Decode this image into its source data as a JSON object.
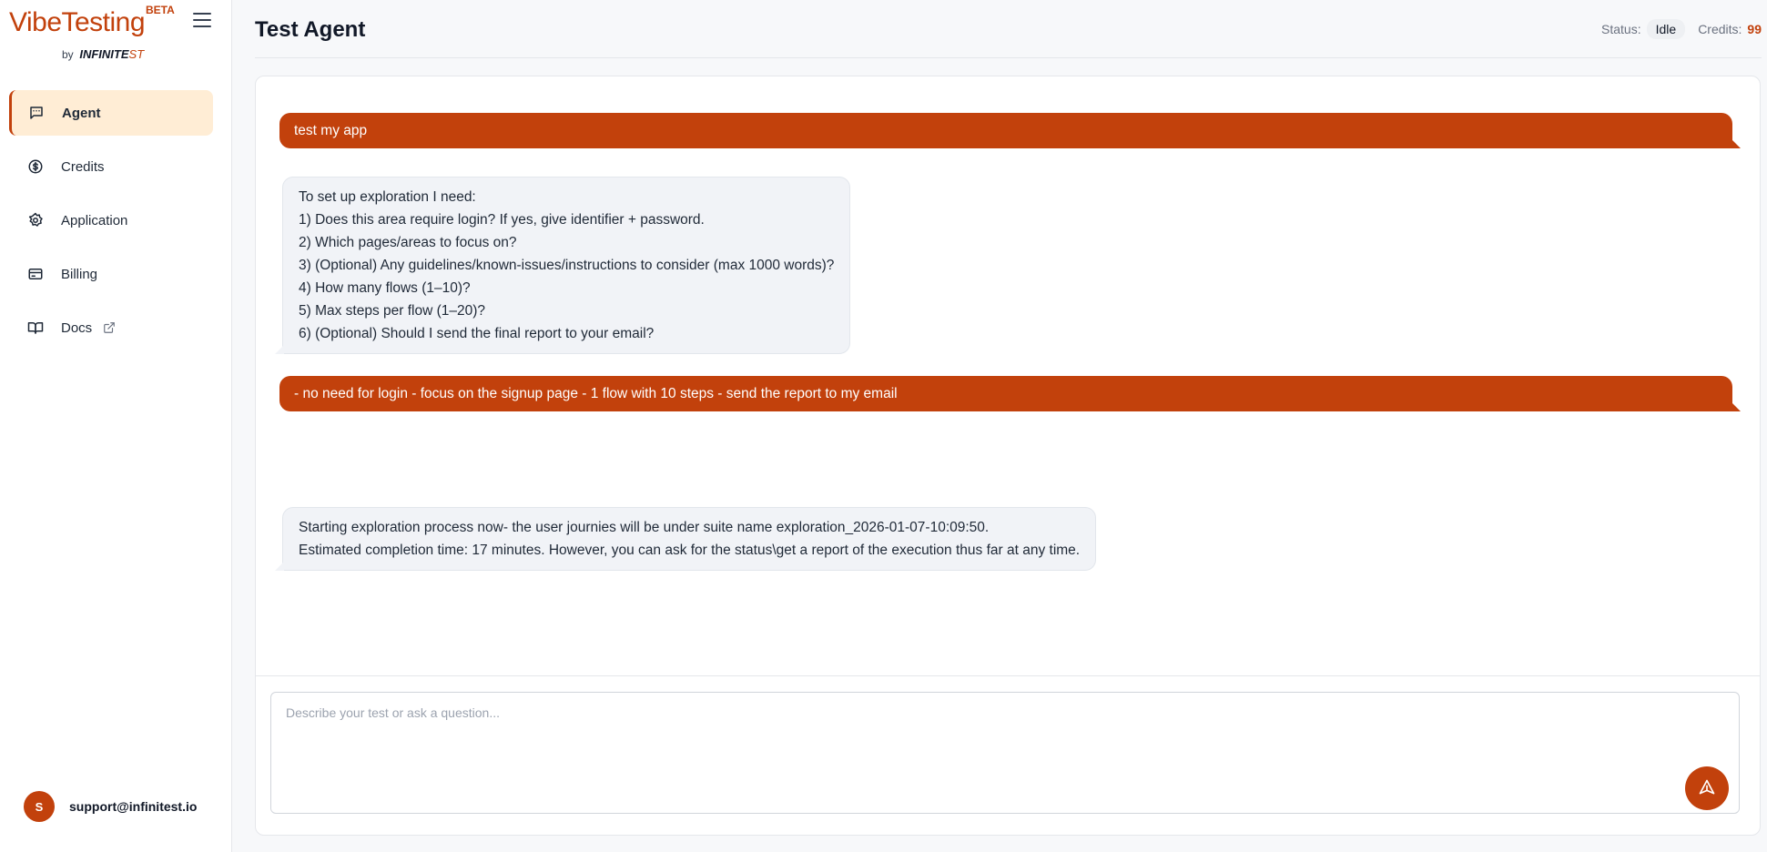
{
  "brand": {
    "name": "VibeTesting",
    "badge": "BETA",
    "by_prefix": "by",
    "by_company_main": "INFINITE",
    "by_company_accent": "ST",
    "accent_color": "#c2410c"
  },
  "sidebar": {
    "items": [
      {
        "label": "Agent",
        "icon": "chat-icon",
        "active": true
      },
      {
        "label": "Credits",
        "icon": "dollar-circle-icon",
        "active": false
      },
      {
        "label": "Application",
        "icon": "gear-icon",
        "active": false
      },
      {
        "label": "Billing",
        "icon": "credit-card-icon",
        "active": false
      },
      {
        "label": "Docs",
        "icon": "book-icon",
        "active": false,
        "external": true
      }
    ],
    "user": {
      "initial": "S",
      "email": "support@infinitest.io"
    }
  },
  "header": {
    "title": "Test Agent",
    "status_label": "Status:",
    "status_value": "Idle",
    "credits_label": "Credits:",
    "credits_value": "99"
  },
  "chat": {
    "messages": [
      {
        "role": "user",
        "lines": [
          "test my app"
        ]
      },
      {
        "role": "agent",
        "lines": [
          "To set up exploration I need:",
          "1) Does this area require login? If yes, give identifier + password.",
          "2) Which pages/areas to focus on?",
          "3) (Optional) Any guidelines/known-issues/instructions to consider (max 1000 words)?",
          "4) How many flows (1–10)?",
          "5) Max steps per flow (1–20)?",
          "6) (Optional) Should I send the final report to your email?"
        ]
      },
      {
        "role": "user",
        "lines": [
          "- no need for login",
          " - focus on the signup page",
          " - 1 flow with 10 steps",
          " - send the report to my email"
        ]
      },
      {
        "role": "agent",
        "lines": [
          "Starting exploration process now- the user journies will be under suite name exploration_2026-01-07-10:09:50.",
          "Estimated completion time: 17 minutes. However, you can ask for the status\\get a report of the execution thus far at any time."
        ]
      }
    ],
    "composer_placeholder": "Describe your test or ask a question...",
    "send_icon": "send-icon"
  }
}
